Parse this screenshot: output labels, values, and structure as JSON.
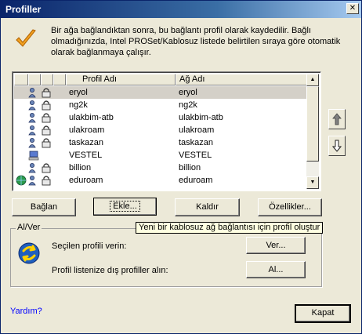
{
  "window": {
    "title": "Profiller",
    "close_glyph": "✕"
  },
  "description": "Bir ağa bağlandıktan sonra, bu bağlantı profil olarak kaydedilir. Bağlı olmadığınızda, Intel PROSet/Kablosuz listede belirtilen sıraya göre otomatik olarak bağlanmaya çalışır.",
  "list": {
    "columns": [
      "Profil Adı",
      "Ağ Adı"
    ],
    "rows": [
      {
        "profile": "eryol",
        "network": "eryol",
        "icon": "user-lock",
        "selected": true
      },
      {
        "profile": "ng2k",
        "network": "ng2k",
        "icon": "user-lock"
      },
      {
        "profile": "ulakbim-atb",
        "network": "ulakbim-atb",
        "icon": "user-lock"
      },
      {
        "profile": "ulakroam",
        "network": "ulakroam",
        "icon": "user-lock"
      },
      {
        "profile": "taskazan",
        "network": "taskazan",
        "icon": "user-lock"
      },
      {
        "profile": "VESTEL",
        "network": "VESTEL",
        "icon": "computer"
      },
      {
        "profile": "billion",
        "network": "billion",
        "icon": "user-lock"
      },
      {
        "profile": "eduroam",
        "network": "eduroam",
        "icon": "globe-user-lock"
      }
    ]
  },
  "buttons": {
    "connect": "Bağlan",
    "add": "Ekle...",
    "remove": "Kaldır",
    "properties": "Özellikler...",
    "export": "Ver...",
    "import": "Al...",
    "close": "Kapat"
  },
  "tooltip": "Yeni bir kablosuz ağ bağlantısı için profil oluştur",
  "group": {
    "title": "Al/Ver",
    "export_label": "Seçilen profili verin:",
    "import_label": "Profil listenize dış profiller alın:"
  },
  "help": "Yardım?"
}
